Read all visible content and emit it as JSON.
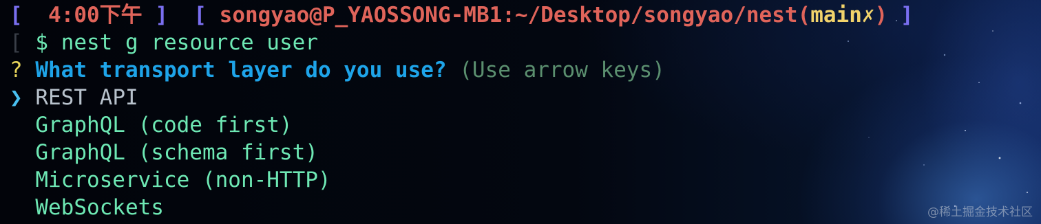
{
  "prompt": {
    "open_bracket": "[",
    "time": "4:00下午",
    "close_bracket": "]",
    "path_open_bracket": "[",
    "user_path": "songyao@P_YAOSSONG-MB1:~/Desktop/songyao/nest",
    "branch_open": "(",
    "branch": "main",
    "dirty_marker": "✗",
    "branch_close": ")",
    "path_close_bracket": "]",
    "left_edge": "[",
    "dollar": "$",
    "command": "nest g resource user"
  },
  "question": {
    "mark": "?",
    "text": "What transport layer do you use?",
    "hint": "(Use arrow keys)"
  },
  "options": {
    "pointer": "❯",
    "selected": "REST API",
    "items": [
      "GraphQL (code first)",
      "GraphQL (schema first)",
      "Microservice (non-HTTP)",
      "WebSockets"
    ]
  },
  "watermark": "@稀土掘金技术社区",
  "colors": {
    "bracket": "#7a6ff0",
    "path": "#e0645a",
    "branch": "#f2d36b",
    "command": "#6ee8b4",
    "question": "#1ea4e9",
    "hint": "#5b8f6f",
    "pointer": "#49c0f0",
    "selected": "#b8c2cc"
  }
}
